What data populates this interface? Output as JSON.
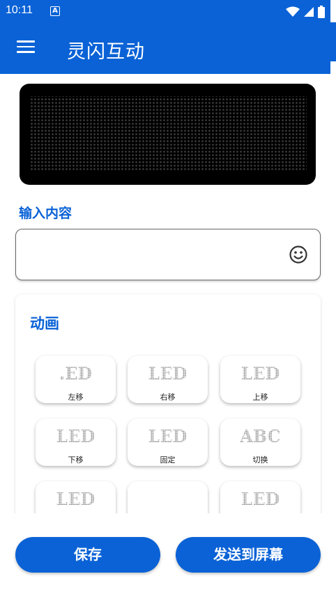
{
  "status_bar": {
    "time": "10:11",
    "notification_icon": "A"
  },
  "app_bar": {
    "title": "灵闪互动",
    "menu_icon": "menu-icon"
  },
  "input_section": {
    "label": "输入内容",
    "value": "",
    "placeholder": "",
    "emoji_icon": "smiley-icon"
  },
  "animation_section": {
    "title": "动画",
    "items": [
      {
        "preview": ".ED",
        "label": "左移"
      },
      {
        "preview": "LED",
        "label": "右移"
      },
      {
        "preview": "LED",
        "label": "上移"
      },
      {
        "preview": "LED",
        "label": "下移"
      },
      {
        "preview": "LED",
        "label": "固定"
      },
      {
        "preview": "ABC",
        "label": "切换"
      },
      {
        "preview": "LED",
        "label": ""
      },
      {
        "preview": "",
        "label": ""
      },
      {
        "preview": "LED",
        "label": ""
      }
    ]
  },
  "actions": {
    "save": "保存",
    "send": "发送到屏幕"
  },
  "colors": {
    "primary": "#0a62d6",
    "led_off": "#3a3a3a",
    "background": "#ffffff"
  }
}
